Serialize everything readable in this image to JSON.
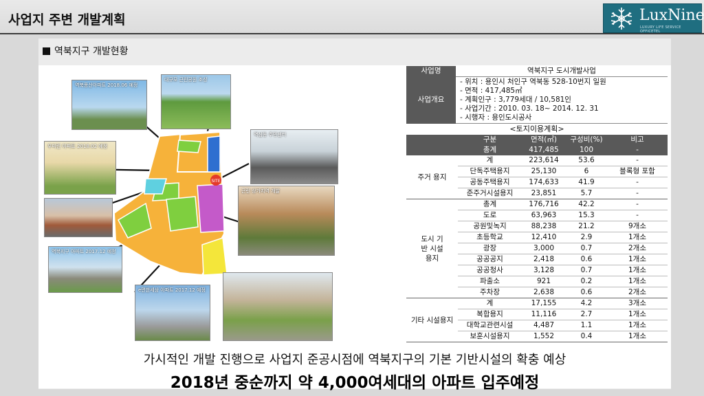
{
  "header": {
    "title": "사업지 주변 개발계획",
    "logo_text": "LuxNine",
    "logo_sub": "LUXURY LIFE SERVICE OFFICETEL"
  },
  "section": {
    "label": "역북지구 개발현황"
  },
  "photos": [
    {
      "caption": "역북풍산아파트 2018.06 예정"
    },
    {
      "caption": "대규모 근린공원 조성"
    },
    {
      "caption": "우미린 아파트 2018.02 예정"
    },
    {
      "caption": "역삼동 주민센터"
    },
    {
      "caption": ""
    },
    {
      "caption": "근린 상가지역 개발"
    },
    {
      "caption": "역북지구 아파트 2017.12 예정"
    },
    {
      "caption": ""
    },
    {
      "caption": "e편한세상 아파트 2017.12 예정"
    }
  ],
  "project": {
    "name_label": "사업명",
    "name_value": "역북지구 도시개발사업",
    "overview_label": "사업개요",
    "overview_lines": [
      "- 위치 : 용인시 처인구 역북동 528-10번지 일원",
      "- 면적 : 417,485㎡",
      "- 계획인구 : 3,779세대 / 10,581인",
      "- 사업기간 : 2010. 03. 18~ 2014. 12. 31",
      "- 시행자 : 용인도시공사"
    ]
  },
  "land_use": {
    "title": "<토지이용계획>",
    "headers": [
      "구분",
      "면적(㎡)",
      "구성비(%)",
      "비고"
    ],
    "total": {
      "label": "총계",
      "area": "417,485",
      "ratio": "100",
      "note": "-"
    },
    "groups": [
      {
        "name": "주거 용지",
        "rows": [
          {
            "label": "계",
            "area": "223,614",
            "ratio": "53.6",
            "note": "-"
          },
          {
            "label": "단독주택용지",
            "area": "25,130",
            "ratio": "6",
            "note": "블록형 포함"
          },
          {
            "label": "공동주택용지",
            "area": "174,633",
            "ratio": "41.9",
            "note": "-"
          },
          {
            "label": "준주거시설용지",
            "area": "23,851",
            "ratio": "5.7",
            "note": "-"
          }
        ]
      },
      {
        "name": "도시 기반 시설 용지",
        "rows": [
          {
            "label": "총계",
            "area": "176,716",
            "ratio": "42.2",
            "note": "-"
          },
          {
            "label": "도로",
            "area": "63,963",
            "ratio": "15.3",
            "note": "-"
          },
          {
            "label": "공원및녹지",
            "area": "88,238",
            "ratio": "21.2",
            "note": "9개소"
          },
          {
            "label": "초등학교",
            "area": "12,410",
            "ratio": "2.9",
            "note": "1개소"
          },
          {
            "label": "광장",
            "area": "3,000",
            "ratio": "0.7",
            "note": "2개소"
          },
          {
            "label": "공공공지",
            "area": "2,418",
            "ratio": "0.6",
            "note": "1개소"
          },
          {
            "label": "공공청사",
            "area": "3,128",
            "ratio": "0.7",
            "note": "1개소"
          },
          {
            "label": "파출소",
            "area": "921",
            "ratio": "0.2",
            "note": "1개소"
          },
          {
            "label": "주차장",
            "area": "2,638",
            "ratio": "0.6",
            "note": "2개소"
          }
        ]
      },
      {
        "name": "기타 시설용지",
        "rows": [
          {
            "label": "계",
            "area": "17,155",
            "ratio": "4.2",
            "note": "3개소"
          },
          {
            "label": "복합용지",
            "area": "11,116",
            "ratio": "2.7",
            "note": "1개소"
          },
          {
            "label": "대학교관련시설",
            "area": "4,487",
            "ratio": "1.1",
            "note": "1개소"
          },
          {
            "label": "보훈시설용지",
            "area": "1,552",
            "ratio": "0.4",
            "note": "1개소"
          }
        ]
      }
    ]
  },
  "map": {
    "site_marker": "SITE"
  },
  "footer": {
    "line1": "가시적인 개발 진행으로 사업지 준공시점에 역북지구의 기본 기반시설의 확충 예상",
    "line2": "2018년 중순까지 약 4,000여세대의 아파트 입주예정"
  },
  "colors": {
    "table_header": "#595959",
    "logo_bg": "#1f6e80",
    "residential": "#f6b23a",
    "green_area": "#7fcf3f",
    "commercial": "#c45ac9",
    "school": "#2f6fd0"
  }
}
